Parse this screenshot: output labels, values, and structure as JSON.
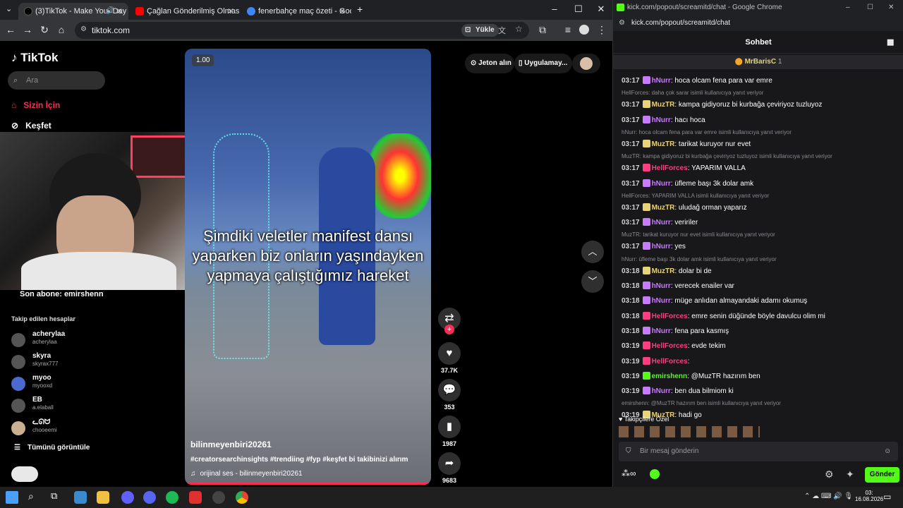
{
  "left_browser": {
    "tabs": [
      {
        "title": "(3)TikTok - Make Your Day",
        "color": "#000000",
        "active": true
      },
      {
        "title": "Çağlan Gönderilmiş Olmasını D",
        "color": "#ff0000",
        "active": false
      },
      {
        "title": "fenerbahçe maç özeti - Google",
        "color": "#4285f4",
        "active": false
      }
    ],
    "url": "tiktok.com",
    "install_label": "Yükle"
  },
  "tiktok": {
    "logo": "TikTok",
    "search_placeholder": "Ara",
    "nav": [
      "Sizin İçin",
      "Keşfet"
    ],
    "last_sub": "Son abone: emirshenn",
    "following_header": "Takip edilen hesaplar",
    "following": [
      {
        "name": "acherylaa",
        "handle": "acherylaa"
      },
      {
        "name": "skyra",
        "handle": "skyrax777"
      },
      {
        "name": "myoo",
        "handle": "myooxd"
      },
      {
        "name": "EB",
        "handle": "a.elaball"
      },
      {
        "name": "ᓚᘏᗢ",
        "handle": "chooeemi"
      }
    ],
    "see_all": "Tümünü görüntüle",
    "top_actions": {
      "coins": "Jeton alın",
      "app": "Uygulamay..."
    },
    "video": {
      "speed": "1.00",
      "caption": "Şimdiki veletler manifest dansı yaparken biz onların yaşındayken yapmaya çalıştığımız hareket",
      "username": "bilinmeyenbiri20261",
      "hashtags": "#creatorsearchinsights #trendiing #fyp #keşfet bi takibinizi alırım",
      "sound": "orijinal ses - bilinmeyenbiri20261"
    },
    "actions": {
      "likes": "37.7K",
      "comments": "353",
      "saves": "1987",
      "shares": "9683"
    }
  },
  "kick": {
    "window_title": "kick.com/popout/screamitd/chat - Google Chrome",
    "url": "kick.com/popout/screamitd/chat",
    "header": "Sohbet",
    "pinned_user": "MrBarisC",
    "pinned_count": "1",
    "messages": [
      {
        "time": "03:17",
        "user": "hNurr",
        "color": "#c97bff",
        "text": "hoca olcam fena para var emre",
        "reply": ""
      },
      {
        "time": "03:17",
        "user": "MuzTR",
        "color": "#e8d37a",
        "text": "kampa gidiyoruz bi kurbağa çeviriyoz tuzluyoz",
        "reply": "HellForces: daha çok sarar isimli kullanıcıya yanıt veriyor"
      },
      {
        "time": "03:17",
        "user": "hNurr",
        "color": "#c97bff",
        "text": "hacı hoca",
        "reply": ""
      },
      {
        "time": "03:17",
        "user": "MuzTR",
        "color": "#e8d37a",
        "text": "tarikat kuruyor nur evet",
        "reply": "hNurr: hoca olcam fena para var emre isimli kullanıcıya yanıt veriyor"
      },
      {
        "time": "03:17",
        "user": "HellForces",
        "color": "#ff3d7f",
        "text": "YAPARIM VALLA",
        "reply": "MuzTR: kampa gidiyoruz bi kurbağa çeviriyoz tuzluyoz isimli kullanıcıya yanıt veriyor"
      },
      {
        "time": "03:17",
        "user": "hNurr",
        "color": "#c97bff",
        "text": "üfleme başı 3k dolar amk",
        "reply": ""
      },
      {
        "time": "03:17",
        "user": "MuzTR",
        "color": "#e8d37a",
        "text": "uludağ orman yaparız",
        "reply": "HellForces: YAPARIM VALLA isimli kullanıcıya yanıt veriyor"
      },
      {
        "time": "03:17",
        "user": "hNurr",
        "color": "#c97bff",
        "text": "veririler",
        "reply": ""
      },
      {
        "time": "03:17",
        "user": "hNurr",
        "color": "#c97bff",
        "text": "yes",
        "reply": "MuzTR: tarikat kuruyor nur evet isimli kullanıcıya yanıt veriyor"
      },
      {
        "time": "03:18",
        "user": "MuzTR",
        "color": "#e8d37a",
        "text": "dolar bi de",
        "reply": "hNurr: üfleme başı 3k dolar amk isimli kullanıcıya yanıt veriyor"
      },
      {
        "time": "03:18",
        "user": "hNurr",
        "color": "#c97bff",
        "text": "verecek enailer var",
        "reply": ""
      },
      {
        "time": "03:18",
        "user": "hNurr",
        "color": "#c97bff",
        "text": "müge anlıdan almayandaki adamı okumuş",
        "reply": ""
      },
      {
        "time": "03:18",
        "user": "HellForces",
        "color": "#ff3d7f",
        "text": "emre senin düğünde böyle davulcu olim mi",
        "reply": ""
      },
      {
        "time": "03:18",
        "user": "hNurr",
        "color": "#c97bff",
        "text": "fena para kasmış",
        "reply": ""
      },
      {
        "time": "03:19",
        "user": "HellForces",
        "color": "#ff3d7f",
        "text": "evde tekim",
        "reply": ""
      },
      {
        "time": "03:19",
        "user": "HellForces",
        "color": "#ff3d7f",
        "text": "",
        "reply": ""
      },
      {
        "time": "03:19",
        "user": "emirshenn",
        "color": "#53fc18",
        "text": "@MuzTR hazırım ben",
        "reply": ""
      },
      {
        "time": "03:19",
        "user": "hNurr",
        "color": "#c97bff",
        "text": "ben dua bilmiom ki",
        "reply": ""
      },
      {
        "time": "03:19",
        "user": "MuzTR",
        "color": "#e8d37a",
        "text": "hadi go",
        "reply": "emirshenn: @MuzTR hazırım ben isimli kullanıcıya yanıt veriyor"
      }
    ],
    "followers_only": "Takipçilere Özel",
    "input_placeholder": "Bir mesaj gönderin",
    "send_label": "Gönder"
  },
  "taskbar": {
    "time": "03:",
    "date": "16.08.2026"
  }
}
